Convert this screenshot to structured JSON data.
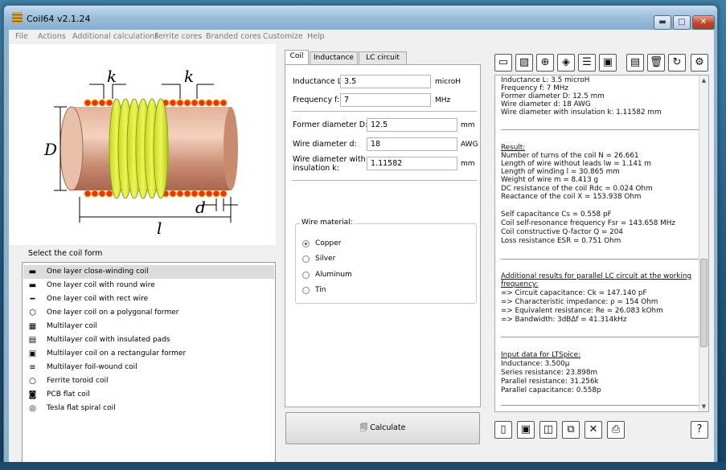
{
  "window": {
    "title": "Coil64 v2.1.24",
    "controls": {
      "minimize": "▬",
      "maximize": "□",
      "close": "✕"
    }
  },
  "menu": [
    "File",
    "Actions",
    "Additional calculations",
    "Ferrite cores",
    "Branded cores",
    "Customize",
    "Help"
  ],
  "diagram": {
    "k_top_left": "k",
    "k_top_right": "k",
    "d_side": "D",
    "l_bottom": "l",
    "d_wire": "d"
  },
  "coil_form": {
    "label": "Select the coil form",
    "items": [
      {
        "label": "One layer close-winding coil",
        "icon": "one-layer-close-icon",
        "glyph": "▬",
        "selected": true
      },
      {
        "label": "One layer coil with round wire",
        "icon": "round-wire-icon",
        "glyph": "▬",
        "selected": false
      },
      {
        "label": "One layer coil with rect wire",
        "icon": "rect-wire-icon",
        "glyph": "━",
        "selected": false
      },
      {
        "label": "One layer coil on a polygonal former",
        "icon": "polygon-icon",
        "glyph": "⬡",
        "selected": false
      },
      {
        "label": "Multilayer coil",
        "icon": "multilayer-icon",
        "glyph": "▦",
        "selected": false
      },
      {
        "label": "Multilayer coil with insulated pads",
        "icon": "multilayer-pads-icon",
        "glyph": "▤",
        "selected": false
      },
      {
        "label": "Multilayer coil on a rectangular former",
        "icon": "rect-former-icon",
        "glyph": "▣",
        "selected": false
      },
      {
        "label": "Multilayer foil-wound coil",
        "icon": "foil-icon",
        "glyph": "≡",
        "selected": false
      },
      {
        "label": "Ferrite toroid coil",
        "icon": "toroid-icon",
        "glyph": "○",
        "selected": false
      },
      {
        "label": "PCB flat coil",
        "icon": "pcb-coil-icon",
        "glyph": "◙",
        "selected": false
      },
      {
        "label": "Tesla flat spiral coil",
        "icon": "spiral-icon",
        "glyph": "◎",
        "selected": false
      }
    ]
  },
  "tabs": [
    "Coil",
    "Inductance",
    "LC circuit"
  ],
  "form": {
    "inductance": {
      "label": "Inductance L:",
      "value": "3.5",
      "unit": "microH"
    },
    "frequency": {
      "label": "Frequency f:",
      "value": "7",
      "unit": "MHz"
    },
    "former_diameter": {
      "label": "Former diameter D:",
      "value": "12.5",
      "unit": "mm"
    },
    "wire_diameter": {
      "label": "Wire diameter d:",
      "value": "18",
      "unit": "AWG"
    },
    "wire_insulation_line1": "Wire diameter with",
    "wire_insulation_line2": "insulation k:",
    "wire_insulation_value": "1.11582",
    "wire_insulation_unit": "mm",
    "material_title": "Wire material:",
    "materials": [
      {
        "label": "Copper",
        "checked": true
      },
      {
        "label": "Silver",
        "checked": false
      },
      {
        "label": "Aluminum",
        "checked": false
      },
      {
        "label": "Tin",
        "checked": false
      }
    ]
  },
  "calculate_label": "Calculate",
  "results": {
    "input": [
      "Inductance L: 3.5 microH",
      "Frequency f: 7 MHz",
      "Former diameter D: 12.5 mm",
      "Wire diameter d: 18 AWG",
      "Wire diameter with insulation k: 1.11582 mm"
    ],
    "result_title": "Result:",
    "result": [
      "Number of turns of the coil N = 26.661",
      "Length of wire without leads lw = 1.141 m",
      "Length of winding l = 30.865 mm",
      "Weight of wire m = 8.413 g",
      "DC resistance of the coil Rdc = 0.024 Ohm",
      "Reactance of the coil X = 153.938 Ohm"
    ],
    "result2": [
      "Self capacitance Cs = 0.558 pF",
      "Coil self-resonance frequency Fsr = 143.658 MHz",
      "Coil constructive Q-factor Q = 204",
      "Loss resistance ESR = 0.751 Ohm"
    ],
    "lc_title_1": "Additional results for parallel LC circuit at the working",
    "lc_title_2": "frequency:",
    "lc": [
      "=> Circuit capacitance: Ck = 147.140 pF",
      "=> Characteristic impedance: ρ = 154 Ohm",
      "=> Equivalent resistance: Re = 26.083 kOhm",
      "=> Bandwidth: 3dBΔf = 41.314kHz"
    ],
    "spice_title": "Input data for LTSpice:",
    "spice": [
      "Inductance: 3.500μ",
      "Series resistance: 23.898m",
      "Parallel resistance: 31.256k",
      "Parallel capacitance: 0.558p"
    ]
  }
}
